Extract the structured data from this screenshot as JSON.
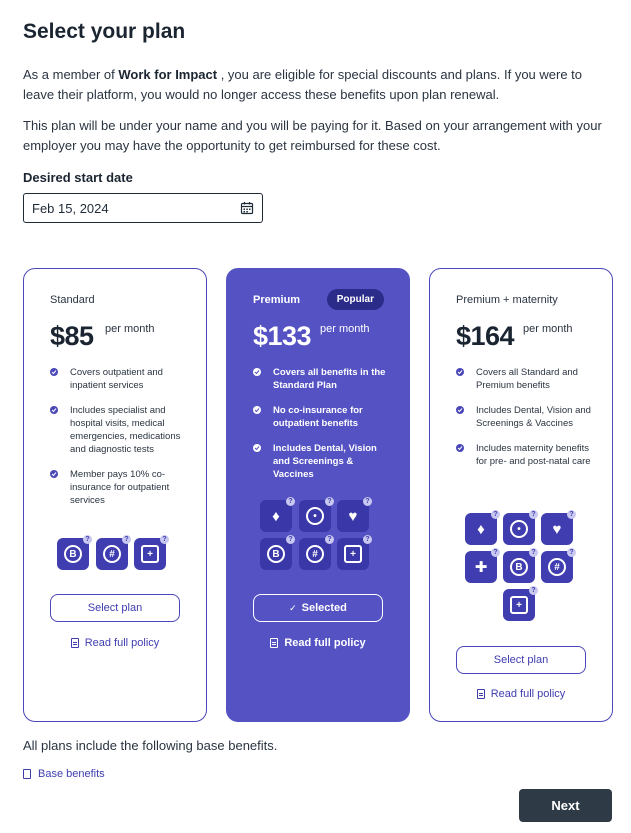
{
  "page": {
    "title": "Select your plan",
    "intro_prefix": "As a member of ",
    "intro_company": "Work for Impact",
    "intro_suffix": " , you are eligible for special discounts and plans. If you were to leave their platform, you would no longer access these benefits upon plan renewal.",
    "reimburse_text": "This plan will be under your name and you will be paying for it. Based on your arrangement with your employer you may have the opportunity to get reimbursed for these cost."
  },
  "date_field": {
    "label": "Desired start date",
    "value": "Feb 15, 2024",
    "icon": "calendar-icon"
  },
  "plans": [
    {
      "name": "Standard",
      "price": "$85",
      "period": "per month",
      "features": [
        "Covers outpatient and inpatient services",
        "Includes specialist and hospital visits, medical emergencies, medications and diagnostic tests",
        "Member pays 10% co-insurance for outpatient services"
      ],
      "benefit_icons": [
        "pill-icon",
        "globe-icon",
        "id-card-icon"
      ],
      "button_label": "Select plan",
      "policy_label": "Read full policy"
    },
    {
      "name": "Premium",
      "badge": "Popular",
      "price": "$133",
      "period": "per month",
      "features": [
        "Covers all benefits in the Standard Plan",
        "No co-insurance for outpatient benefits",
        "Includes Dental, Vision and Screenings & Vaccines"
      ],
      "benefit_icons": [
        "tooth-icon",
        "eye-icon",
        "vaccine-icon",
        "pill-icon",
        "globe-icon",
        "id-card-icon"
      ],
      "button_label": "Selected",
      "policy_label": "Read full policy"
    },
    {
      "name": "Premium + maternity",
      "price": "$164",
      "period": "per month",
      "features": [
        "Covers all Standard and Premium benefits",
        "Includes Dental, Vision and Screenings & Vaccines",
        "Includes maternity benefits for pre- and post-natal care"
      ],
      "benefit_icons": [
        "tooth-icon",
        "eye-icon",
        "vaccine-icon",
        "syringe-icon",
        "pill-icon",
        "globe-icon",
        "id-card-icon"
      ],
      "button_label": "Select plan",
      "policy_label": "Read full policy"
    }
  ],
  "footer": {
    "base_text": "All plans include the following base benefits.",
    "base_link": "Base benefits",
    "next_label": "Next"
  },
  "colors": {
    "accent": "#4a47b8",
    "highlight_card": "#5553c4",
    "next_button": "#2e3a46"
  }
}
